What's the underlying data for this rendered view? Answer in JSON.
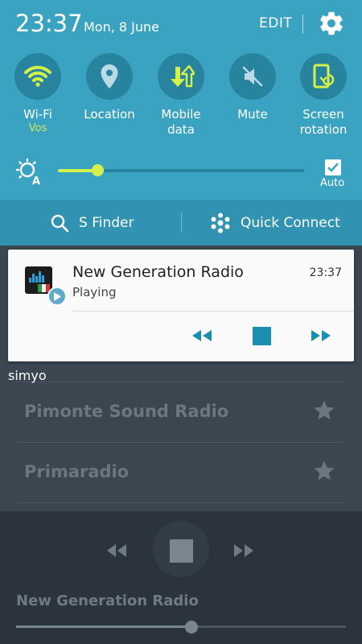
{
  "status_bar": {
    "time": "23:37",
    "date": "Mon, 8 June",
    "edit_label": "EDIT"
  },
  "quick_tiles": [
    {
      "label": "Wi-Fi",
      "sub": "Vos",
      "icon": "wifi-icon",
      "active": true
    },
    {
      "label": "Location",
      "sub": "",
      "icon": "location-icon",
      "active": false
    },
    {
      "label": "Mobile\ndata",
      "sub": "",
      "icon": "mobile-data-icon",
      "active": true
    },
    {
      "label": "Mute",
      "sub": "",
      "icon": "mute-icon",
      "active": false
    },
    {
      "label": "Screen\nrotation",
      "sub": "",
      "icon": "screen-rotation-icon",
      "active": true
    }
  ],
  "brightness": {
    "level": 0.16,
    "auto_label": "Auto",
    "auto_checked": true
  },
  "finder": {
    "s_finder_label": "S Finder",
    "quick_connect_label": "Quick Connect"
  },
  "notification": {
    "title": "New Generation Radio",
    "time": "23:37",
    "status": "Playing"
  },
  "carrier": "simyo",
  "stations": [
    {
      "name": "Pimonte Sound Radio"
    },
    {
      "name": "Primaradio"
    }
  ],
  "player": {
    "title": "New Generation Radio",
    "progress": 0.53
  },
  "colors": {
    "panel": "#3aa3c2",
    "tile": "#28839f",
    "accent": "#d4f04a",
    "media_controls": "#1a8fb0"
  }
}
